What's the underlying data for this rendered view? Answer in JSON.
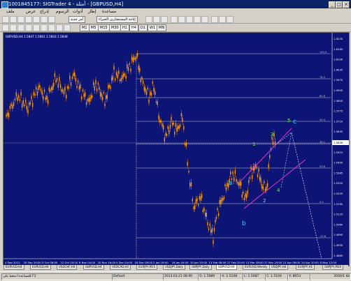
{
  "window": {
    "title": "1001845177: SIGTrader 4 - أمثلة - [GBPUSD,H4]"
  },
  "menu": {
    "items": [
      "ملف",
      "عرض",
      "إدراج",
      "الرسوم",
      "أدوات",
      "إطار",
      "مساعدة"
    ]
  },
  "toolbar": {
    "new_order": "أمر جديد",
    "expert_advisors": "إتاحة المستشارين الخبراء",
    "timeframes": [
      "M1",
      "M5",
      "M15",
      "M30",
      "H1",
      "H4",
      "D1",
      "W1",
      "MN"
    ]
  },
  "chart": {
    "symbol_label": "GBPUSD,H4 1.5847 1.5861 1.5843 1.5848",
    "price_scale": [
      "1.6230",
      "1.6165",
      "1.6100",
      "1.6035",
      "1.5970",
      "1.5905",
      "1.5840",
      "1.5775",
      "1.5710",
      "1.5645",
      "1.5580",
      "1.5515",
      "1.5450",
      "1.5385",
      "1.5320",
      "1.5255",
      "1.5190",
      "1.5125",
      "1.5060",
      "1.4995",
      "1.4930",
      "1.4865"
    ],
    "current_price": "1.5848",
    "fib_levels": [
      "100.0",
      "76.4",
      "61.8",
      "50.0",
      "38.2",
      "23.6",
      "0.0",
      "-23.6",
      "-61.8"
    ],
    "time_scale": [
      "4 Sep 2012",
      "20 Sep 20:00",
      "5 Oct 08:00",
      "22 Oct 20:00",
      "6 Nov 04:00",
      "20 Nov 16:00",
      "4 Dec 04:00",
      "18 Dec 08:00",
      "2 Jan 16:00",
      "16 Jan 04:00",
      "30 Jan 20:00",
      "13 Feb 08:00",
      "27 Feb 20:00",
      "13 Mar 08:00",
      "27 Mar 20:00",
      "10 Apr 08:00",
      "24 Apr 20:00",
      "8 May 12:00"
    ],
    "wave_labels": {
      "a": "a",
      "b": "b",
      "w1": "1",
      "w2": "2",
      "w3": "3",
      "w4": "4",
      "w5": "5",
      "c": "c"
    }
  },
  "tabs": [
    "EURUSD,H4",
    "EURUSD,H4",
    "USDCHF,H4",
    "GBPUSD,H4",
    "USDCAD,H4",
    "EURJPY,M15",
    "USDJPY,Daily",
    "GBPJPY,Daily",
    "GBPUSD,H4",
    "EURUSD,Weekly",
    "USDJPY,H4",
    "EURJPY,H1",
    "GBPJPY,M30"
  ],
  "status": {
    "help": "للمساعدة اضغط على F1",
    "profile": "Default",
    "datetime": "2013.03.21 08:00",
    "open": "O: 1.5089",
    "high": "H: 1.5108",
    "low": "L: 1.5087",
    "close": "C: 1.5104",
    "volume": "V: 8053",
    "traffic": "3500/1 kb"
  },
  "colors": {
    "background": "#0c1476",
    "candles": "#ff9900",
    "fib": "#c8c8c8",
    "channel": "#ff33cc",
    "wave_letters": "#33ccff",
    "wave_numbers": "#66ff33"
  }
}
